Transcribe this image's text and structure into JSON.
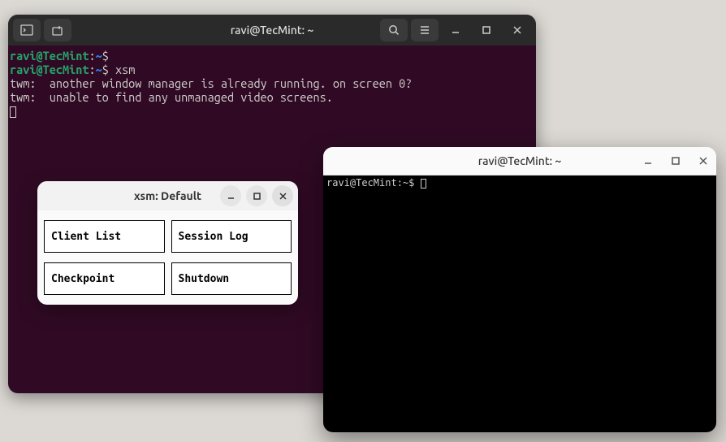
{
  "main_terminal": {
    "title": "ravi@TecMint: ~",
    "prompt": {
      "user": "ravi",
      "host": "TecMint",
      "path": "~",
      "symbol": "$"
    },
    "lines": {
      "l1_cmd": "",
      "l2_cmd": "xsm",
      "l3": "twm:  another window manager is already running. on screen 0?",
      "l4": "twm:  unable to find any unmanaged video screens."
    }
  },
  "xsm": {
    "title": "xsm: Default",
    "buttons": {
      "client_list": "Client List",
      "session_log": "Session Log",
      "checkpoint": "Checkpoint",
      "shutdown": "Shutdown"
    }
  },
  "white_terminal": {
    "title": "ravi@TecMint: ~",
    "prompt": "ravi@TecMint:~$ "
  }
}
